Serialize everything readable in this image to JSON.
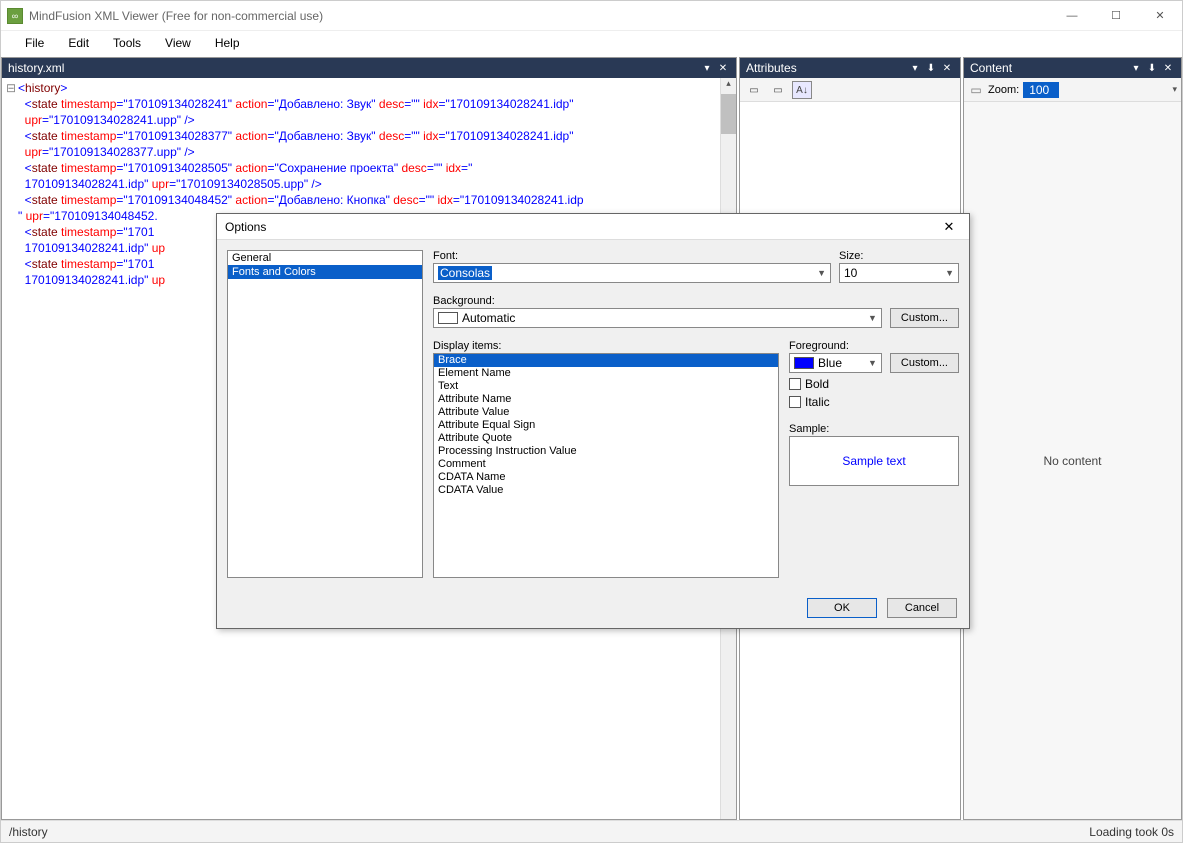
{
  "titlebar": {
    "title": "MindFusion XML Viewer (Free for non-commercial use)"
  },
  "menu": {
    "file": "File",
    "edit": "Edit",
    "tools": "Tools",
    "view": "View",
    "help": "Help"
  },
  "xml_tab": "history.xml",
  "xml_lines": [
    {
      "indent": 0,
      "prefix": "-",
      "parts": [
        {
          "t": "<",
          "c": "b"
        },
        {
          "t": "history",
          "c": "en"
        },
        {
          "t": ">",
          "c": "b"
        }
      ]
    },
    {
      "indent": 1,
      "prefix": "",
      "parts": [
        {
          "t": "<",
          "c": "b"
        },
        {
          "t": "state ",
          "c": "en"
        },
        {
          "t": "timestamp",
          "c": "an"
        },
        {
          "t": "=",
          "c": "b"
        },
        {
          "t": "\"170109134028241\"",
          "c": "av"
        },
        {
          "t": " ",
          "c": ""
        },
        {
          "t": "action",
          "c": "an"
        },
        {
          "t": "=",
          "c": "b"
        },
        {
          "t": "\"Добавлено: Звук\"",
          "c": "av"
        },
        {
          "t": " ",
          "c": ""
        },
        {
          "t": "desc",
          "c": "an"
        },
        {
          "t": "=",
          "c": "b"
        },
        {
          "t": "\"\"",
          "c": "av"
        },
        {
          "t": " ",
          "c": ""
        },
        {
          "t": "idx",
          "c": "an"
        },
        {
          "t": "=",
          "c": "b"
        },
        {
          "t": "\"170109134028241.idp\"",
          "c": "av"
        }
      ]
    },
    {
      "indent": 1,
      "prefix": "",
      "cont": true,
      "parts": [
        {
          "t": "upr",
          "c": "an"
        },
        {
          "t": "=",
          "c": "b"
        },
        {
          "t": "\"170109134028241.upp\"",
          "c": "av"
        },
        {
          "t": " />",
          "c": "b"
        }
      ]
    },
    {
      "indent": 1,
      "prefix": "",
      "parts": [
        {
          "t": "<",
          "c": "b"
        },
        {
          "t": "state ",
          "c": "en"
        },
        {
          "t": "timestamp",
          "c": "an"
        },
        {
          "t": "=",
          "c": "b"
        },
        {
          "t": "\"170109134028377\"",
          "c": "av"
        },
        {
          "t": " ",
          "c": ""
        },
        {
          "t": "action",
          "c": "an"
        },
        {
          "t": "=",
          "c": "b"
        },
        {
          "t": "\"Добавлено: Звук\"",
          "c": "av"
        },
        {
          "t": " ",
          "c": ""
        },
        {
          "t": "desc",
          "c": "an"
        },
        {
          "t": "=",
          "c": "b"
        },
        {
          "t": "\"\"",
          "c": "av"
        },
        {
          "t": " ",
          "c": ""
        },
        {
          "t": "idx",
          "c": "an"
        },
        {
          "t": "=",
          "c": "b"
        },
        {
          "t": "\"170109134028241.idp\"",
          "c": "av"
        }
      ]
    },
    {
      "indent": 1,
      "prefix": "",
      "cont": true,
      "parts": [
        {
          "t": "upr",
          "c": "an"
        },
        {
          "t": "=",
          "c": "b"
        },
        {
          "t": "\"170109134028377.upp\"",
          "c": "av"
        },
        {
          "t": " />",
          "c": "b"
        }
      ]
    },
    {
      "indent": 1,
      "prefix": "",
      "parts": [
        {
          "t": "<",
          "c": "b"
        },
        {
          "t": "state ",
          "c": "en"
        },
        {
          "t": "timestamp",
          "c": "an"
        },
        {
          "t": "=",
          "c": "b"
        },
        {
          "t": "\"170109134028505\"",
          "c": "av"
        },
        {
          "t": " ",
          "c": ""
        },
        {
          "t": "action",
          "c": "an"
        },
        {
          "t": "=",
          "c": "b"
        },
        {
          "t": "\"Сохранение проекта\"",
          "c": "av"
        },
        {
          "t": " ",
          "c": ""
        },
        {
          "t": "desc",
          "c": "an"
        },
        {
          "t": "=",
          "c": "b"
        },
        {
          "t": "\"\"",
          "c": "av"
        },
        {
          "t": " ",
          "c": ""
        },
        {
          "t": "idx",
          "c": "an"
        },
        {
          "t": "=",
          "c": "b"
        },
        {
          "t": "\"",
          "c": "av"
        }
      ]
    },
    {
      "indent": 1,
      "prefix": "",
      "cont": true,
      "parts": [
        {
          "t": "170109134028241.idp\"",
          "c": "av"
        },
        {
          "t": " ",
          "c": ""
        },
        {
          "t": "upr",
          "c": "an"
        },
        {
          "t": "=",
          "c": "b"
        },
        {
          "t": "\"170109134028505.upp\"",
          "c": "av"
        },
        {
          "t": " />",
          "c": "b"
        }
      ]
    },
    {
      "indent": 1,
      "prefix": "",
      "parts": [
        {
          "t": "<",
          "c": "b"
        },
        {
          "t": "state ",
          "c": "en"
        },
        {
          "t": "timestamp",
          "c": "an"
        },
        {
          "t": "=",
          "c": "b"
        },
        {
          "t": "\"170109134048452\"",
          "c": "av"
        },
        {
          "t": " ",
          "c": ""
        },
        {
          "t": "action",
          "c": "an"
        },
        {
          "t": "=",
          "c": "b"
        },
        {
          "t": "\"Добавлено: Кнопка\"",
          "c": "av"
        },
        {
          "t": " ",
          "c": ""
        },
        {
          "t": "desc",
          "c": "an"
        },
        {
          "t": "=",
          "c": "b"
        },
        {
          "t": "\"\"",
          "c": "av"
        },
        {
          "t": " ",
          "c": ""
        },
        {
          "t": "idx",
          "c": "an"
        },
        {
          "t": "=",
          "c": "b"
        },
        {
          "t": "\"170109134028241.idp",
          "c": "av"
        }
      ]
    },
    {
      "indent": 0,
      "prefix": "",
      "cont": true,
      "parts": [
        {
          "t": "\"",
          "c": "av"
        },
        {
          "t": " ",
          "c": ""
        },
        {
          "t": "upr",
          "c": "an"
        },
        {
          "t": "=",
          "c": "b"
        },
        {
          "t": "\"170109134048452.",
          "c": "av"
        }
      ]
    },
    {
      "indent": 1,
      "prefix": "",
      "parts": [
        {
          "t": "<",
          "c": "b"
        },
        {
          "t": "state ",
          "c": "en"
        },
        {
          "t": "timestamp",
          "c": "an"
        },
        {
          "t": "=",
          "c": "b"
        },
        {
          "t": "\"1701",
          "c": "av"
        }
      ]
    },
    {
      "indent": 1,
      "prefix": "",
      "cont": true,
      "parts": [
        {
          "t": "170109134028241.idp\"",
          "c": "av"
        },
        {
          "t": " ",
          "c": ""
        },
        {
          "t": "up",
          "c": "an"
        }
      ]
    },
    {
      "indent": 1,
      "prefix": "",
      "parts": [
        {
          "t": "<",
          "c": "b"
        },
        {
          "t": "state ",
          "c": "en"
        },
        {
          "t": "timestamp",
          "c": "an"
        },
        {
          "t": "=",
          "c": "b"
        },
        {
          "t": "\"1701",
          "c": "av"
        }
      ]
    },
    {
      "indent": 1,
      "prefix": "",
      "cont": true,
      "parts": [
        {
          "t": "170109134028241.idp\"",
          "c": "av"
        },
        {
          "t": " ",
          "c": ""
        },
        {
          "t": "up",
          "c": "an"
        }
      ]
    }
  ],
  "attributes": {
    "title": "Attributes"
  },
  "content": {
    "title": "Content",
    "zoom_label": "Zoom:",
    "zoom_value": "100",
    "empty": "No content"
  },
  "status": {
    "path": "/history",
    "loading": "Loading took 0s"
  },
  "dialog": {
    "title": "Options",
    "categories": [
      "General",
      "Fonts and Colors"
    ],
    "selected_category": 1,
    "font_label": "Font:",
    "font_value": "Consolas",
    "size_label": "Size:",
    "size_value": "10",
    "background_label": "Background:",
    "background_value": "Automatic",
    "custom_btn": "Custom...",
    "display_label": "Display items:",
    "display_items": [
      "Brace",
      "Element Name",
      "Text",
      "Attribute Name",
      "Attribute Value",
      "Attribute Equal Sign",
      "Attribute Quote",
      "Processing Instruction Value",
      "Comment",
      "CDATA Name",
      "CDATA Value"
    ],
    "selected_display": 0,
    "foreground_label": "Foreground:",
    "foreground_value": "Blue",
    "foreground_color": "#0000ff",
    "bold_label": "Bold",
    "italic_label": "Italic",
    "sample_label": "Sample:",
    "sample_text": "Sample text",
    "ok": "OK",
    "cancel": "Cancel"
  }
}
